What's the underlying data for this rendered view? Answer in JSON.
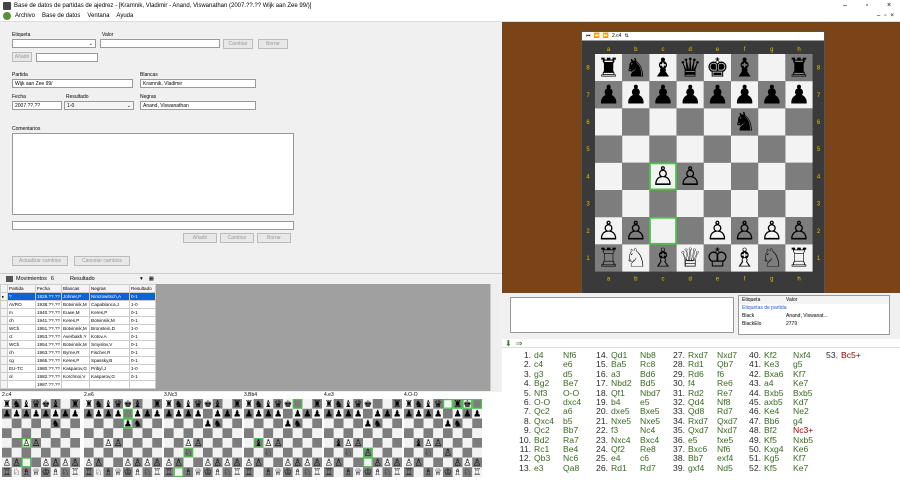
{
  "window": {
    "title": "Base de datos de partidas de ajedrez - [Kramnik, Vladimir - Anand, Viswanathan (2007.??.?? Wijk aan Zee 99/)]",
    "minimize": "–",
    "maximize": "▫",
    "close": "×"
  },
  "menu": {
    "items": [
      "Archivo",
      "Base de datos",
      "Ventana",
      "Ayuda"
    ],
    "mdi_min": "–",
    "mdi_restore": "▫",
    "mdi_close": "×"
  },
  "form": {
    "etiqueta_label": "Etiqueta",
    "valor_label": "Valor",
    "cambiar": "Cambiar",
    "borrar": "Borrar",
    "anadir": "Añadir",
    "partida_label": "Partida",
    "partida_value": "Wijk aan Zee 99/",
    "blancas_label": "Blancas",
    "blancas_value": "Kramnik, Vladimir",
    "fecha_label": "Fecha",
    "fecha_value": "2007.??.??",
    "resultado_label": "Resultado",
    "resultado_value": "1-0",
    "negras_label": "Negras",
    "negras_value": "Anand, Viswanathan",
    "comentarios_label": "Comentarios",
    "anadir2": "Añadir",
    "cambiar2": "Cambiar",
    "borrar2": "Borrar",
    "actualizar": "Actualizar cambios",
    "cancelar": "Cancelar cambios"
  },
  "movbar": {
    "label": "Movimientos",
    "count": "6",
    "resultado": "Resultado"
  },
  "games_table": {
    "columns": [
      "Partida",
      "Fecha",
      "Blancas",
      "Negras",
      "Resultado"
    ],
    "rows": [
      [
        "?",
        "1926.??.??",
        "Johner,P",
        "Nimzowitsch,A",
        "0-1"
      ],
      [
        "AVRO",
        "1938.??.??",
        "Botvinnik,M",
        "Capablanca,J",
        "1-0"
      ],
      [
        "m",
        "1940.??.??",
        "Euwe,M",
        "Keres,P",
        "0-1"
      ],
      [
        "ch",
        "1941.??.??",
        "Keres,P",
        "Botvinnik,M",
        "0-1"
      ],
      [
        "WCh",
        "1951.??.??",
        "Botvinnik,M",
        "Bronstein,D",
        "1-0"
      ],
      [
        "ct",
        "1953.??.??",
        "Averbakh,Y",
        "Kotov,A",
        "0-1"
      ],
      [
        "WCh",
        "1954.??.??",
        "Botvinnik,M",
        "Smyslov,V",
        "0-1"
      ],
      [
        "ch",
        "1963.??.??",
        "Byrne,R",
        "Fischer,R",
        "0-1"
      ],
      [
        "cg",
        "1965.??.??",
        "Keres,P",
        "Spassky,B",
        "0-1"
      ],
      [
        "EU-TC",
        "1980.??.??",
        "Kasparov,G",
        "Pribyl,J",
        "1-0"
      ],
      [
        "ol",
        "1982.??.??",
        "Korchnoi,V",
        "Kasparov,G",
        "0-1"
      ],
      [
        "",
        "1987.??.??",
        "",
        "",
        ""
      ]
    ]
  },
  "thumbs": [
    "2.c4",
    "2.e6",
    "3.Nc3",
    "3.Bb4",
    "4.e3",
    "4.O-O"
  ],
  "board_toolbar": {
    "first": "⏮",
    "prev": "⏪",
    "next": "⏩",
    "move": "2.c4",
    "flip": "⇅"
  },
  "board": {
    "files": [
      "a",
      "b",
      "c",
      "d",
      "e",
      "f",
      "g",
      "h"
    ],
    "ranks": [
      "8",
      "7",
      "6",
      "5",
      "4",
      "3",
      "2",
      "1"
    ],
    "light": "#f3f3f3",
    "dark": "#7d7d7d",
    "highlight": "#4cc34c"
  },
  "tags_panel": {
    "col1": "Etiqueta",
    "col2": "Valor",
    "group": "Etiquetas de partida",
    "rows": [
      [
        "Black",
        "Anand, Viswanat..."
      ],
      [
        "BlackElo",
        "2779"
      ]
    ]
  },
  "notation_icons": {
    "a": "⬇",
    "b": "⇒"
  },
  "moves": [
    [
      "1.",
      "d4",
      "Nf6"
    ],
    [
      "2.",
      "c4",
      "e6"
    ],
    [
      "3.",
      "g3",
      "d5"
    ],
    [
      "4.",
      "Bg2",
      "Be7"
    ],
    [
      "5.",
      "Nf3",
      "O-O"
    ],
    [
      "6.",
      "O-O",
      "dxc4"
    ],
    [
      "7.",
      "Qc2",
      "a6"
    ],
    [
      "8.",
      "Qxc4",
      "b5"
    ],
    [
      "9.",
      "Qc2",
      "Bb7"
    ],
    [
      "10.",
      "Bd2",
      "Ra7"
    ],
    [
      "11.",
      "Rc1",
      "Be4"
    ],
    [
      "12.",
      "Qb3",
      "Nc6"
    ],
    [
      "13.",
      "e3",
      "Qa8"
    ],
    [
      "14.",
      "Qd1",
      "Nb8"
    ],
    [
      "15.",
      "Ba5",
      "Rc8"
    ],
    [
      "16.",
      "a3",
      "Bd6"
    ],
    [
      "17.",
      "Nbd2",
      "Bd5"
    ],
    [
      "18.",
      "Qf1",
      "Nbd7"
    ],
    [
      "19.",
      "b4",
      "e5"
    ],
    [
      "20.",
      "dxe5",
      "Bxe5"
    ],
    [
      "21.",
      "Nxe5",
      "Nxe5"
    ],
    [
      "22.",
      "f3",
      "Nc4"
    ],
    [
      "23.",
      "Nxc4",
      "Bxc4"
    ],
    [
      "24.",
      "Qf2",
      "Re8"
    ],
    [
      "25.",
      "e4",
      "c6"
    ],
    [
      "26.",
      "Rd1",
      "Rd7"
    ],
    [
      "27.",
      "Rxd7",
      "Nxd7"
    ],
    [
      "28.",
      "Rd1",
      "Qb7"
    ],
    [
      "29.",
      "Rd6",
      "f6"
    ],
    [
      "30.",
      "f4",
      "Re6"
    ],
    [
      "31.",
      "Rd2",
      "Re7"
    ],
    [
      "32.",
      "Qd4",
      "Nf8"
    ],
    [
      "33.",
      "Qd8",
      "Rd7"
    ],
    [
      "34.",
      "Rxd7",
      "Qxd7"
    ],
    [
      "35.",
      "Qxd7",
      "Nxd7"
    ],
    [
      "36.",
      "e5",
      "fxe5"
    ],
    [
      "37.",
      "Bxc6",
      "Nf6"
    ],
    [
      "38.",
      "Bb7",
      "exf4"
    ],
    [
      "39.",
      "gxf4",
      "Nd5"
    ],
    [
      "40.",
      "Kf2",
      "Nxf4"
    ],
    [
      "41.",
      "Ke3",
      "g5"
    ],
    [
      "42.",
      "Bxa6",
      "Kf7"
    ],
    [
      "43.",
      "a4",
      "Ke7"
    ],
    [
      "44.",
      "Bxb5",
      "Bxb5"
    ],
    [
      "45.",
      "axb5",
      "Kd7"
    ],
    [
      "46.",
      "Ke4",
      "Ne2"
    ],
    [
      "47.",
      "Bb6",
      "g4"
    ],
    [
      "48.",
      "Bf2",
      "Nc3+"
    ],
    [
      "49.",
      "Kf5",
      "Nxb5"
    ],
    [
      "50.",
      "Kxg4",
      "Ke6"
    ],
    [
      "51.",
      "Kg5",
      "Kf7"
    ],
    [
      "52.",
      "Kf5",
      "Ke7"
    ],
    [
      "53.",
      "Bc5+",
      ""
    ]
  ],
  "colors": {
    "accent": "#0a64d8",
    "board_bg": "#7a4417",
    "move_green": "#3a6a20",
    "move_red": "#a00000"
  }
}
